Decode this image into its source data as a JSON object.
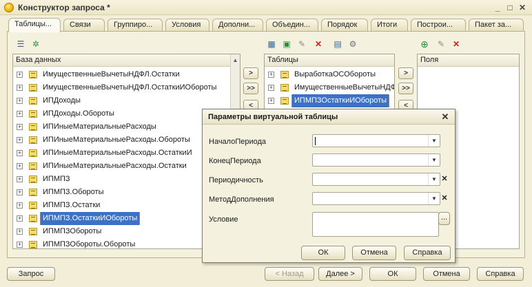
{
  "window": {
    "title": "Конструктор запроса *"
  },
  "tabs": [
    "Таблицы...",
    "Связи",
    "Группиро...",
    "Условия",
    "Дополни...",
    "Объедин...",
    "Порядок",
    "Итоги",
    "Построи...",
    "Пакет за..."
  ],
  "database": {
    "header": "База данных",
    "items": [
      "ИмущественныеВычетыНДФЛ.Остатки",
      "ИмущественныеВычетыНДФЛ.ОстаткиИОбороты",
      "ИПДоходы",
      "ИПДоходы.Обороты",
      "ИПИныеМатериальныеРасходы",
      "ИПИныеМатериальныеРасходы.Обороты",
      "ИПИныеМатериальныеРасходы.ОстаткиИ",
      "ИПИныеМатериальныеРасходы.Остатки",
      "ИПМПЗ",
      "ИПМПЗ.Обороты",
      "ИПМПЗ.Остатки",
      "ИПМПЗ.ОстаткиИОбороты",
      "ИПМПЗОбороты",
      "ИПМПЗОбороты.Обороты"
    ],
    "selected_index": 11
  },
  "transfer_buttons": [
    ">",
    ">>",
    "<"
  ],
  "tables": {
    "header": "Таблицы",
    "items": [
      "ВыработкаОСОбороты",
      "ИмущественныеВычетыНДФ",
      "ИПМПЗОстаткиИОбороты"
    ],
    "selected_index": 2
  },
  "tables_buttons": [
    ">",
    ">>",
    "<"
  ],
  "fields": {
    "header": "Поля"
  },
  "dialog": {
    "title": "Параметры виртуальной таблицы",
    "labels": {
      "period_start": "НачалоПериода",
      "period_end": "КонецПериода",
      "periodicity": "Периодичность",
      "method": "МетодДополнения",
      "condition": "Условие"
    },
    "values": {
      "period_start": "",
      "period_end": "",
      "periodicity": "",
      "method": "",
      "condition": ""
    },
    "buttons": {
      "ok": "ОК",
      "cancel": "Отмена",
      "help": "Справка"
    }
  },
  "bottom": {
    "query": "Запрос",
    "back": "< Назад",
    "next": "Далее >",
    "ok": "ОК",
    "cancel": "Отмена",
    "help": "Справка"
  }
}
